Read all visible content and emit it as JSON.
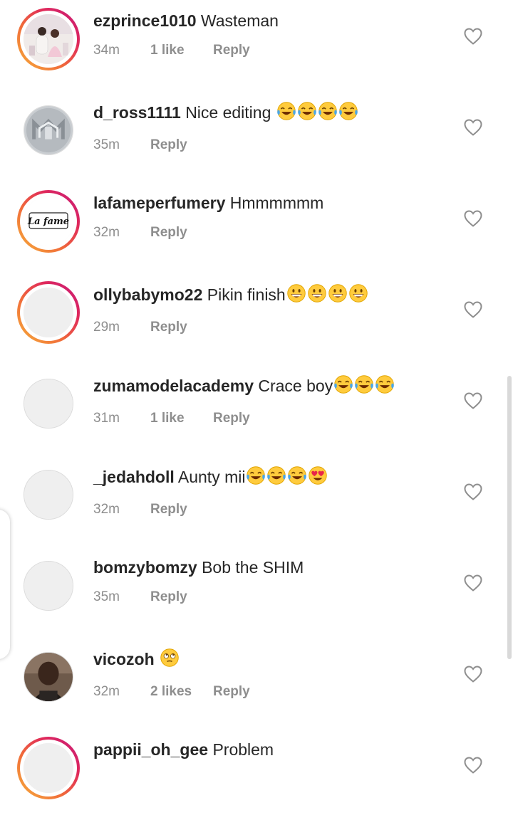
{
  "comments": [
    {
      "username": "ezprince1010",
      "text": "Wasteman",
      "emojis": [],
      "time": "34m",
      "likes": "1 like",
      "reply": "Reply",
      "ring": true,
      "avatar": "photo-couple"
    },
    {
      "username": "d_ross1111",
      "text": "Nice editing ",
      "emojis": [
        "tears-of-joy",
        "tears-of-joy",
        "tears-of-joy",
        "tears-of-joy"
      ],
      "time": "35m",
      "likes": "",
      "reply": "Reply",
      "ring": false,
      "avatar": "logo-metal"
    },
    {
      "username": "lafameperfumery",
      "text": "Hmmmmmm",
      "emojis": [],
      "time": "32m",
      "likes": "",
      "reply": "Reply",
      "ring": true,
      "avatar": "logo-lafame"
    },
    {
      "username": "ollybabymo22",
      "text": "Pikin finish",
      "emojis": [
        "grinning",
        "grinning",
        "grinning",
        "grinning"
      ],
      "time": "29m",
      "likes": "",
      "reply": "Reply",
      "ring": true,
      "avatar": "blank"
    },
    {
      "username": "zumamodelacademy",
      "text": "Crace boy",
      "emojis": [
        "tears-of-joy",
        "tears-of-joy",
        "tears-of-joy"
      ],
      "time": "31m",
      "likes": "1 like",
      "reply": "Reply",
      "ring": false,
      "avatar": "blank"
    },
    {
      "username": "_jedahdoll",
      "text": "Aunty mii",
      "emojis": [
        "tears-of-joy",
        "tears-of-joy",
        "tears-of-joy",
        "heart-eyes"
      ],
      "time": "32m",
      "likes": "",
      "reply": "Reply",
      "ring": false,
      "avatar": "blank"
    },
    {
      "username": "bomzybomzy",
      "text": "Bob the SHIM",
      "emojis": [],
      "time": "35m",
      "likes": "",
      "reply": "Reply",
      "ring": false,
      "avatar": "blank"
    },
    {
      "username": "vicozoh",
      "text": "",
      "emojis": [
        "eye-roll"
      ],
      "time": "32m",
      "likes": "2 likes",
      "reply": "Reply",
      "ring": false,
      "avatar": "photo-man"
    },
    {
      "username": "pappii_oh_gee",
      "text": "Problem",
      "emojis": [],
      "time": "",
      "likes": "",
      "reply": "",
      "ring": true,
      "avatar": "blank"
    }
  ],
  "lafame_logo_text": "La fame",
  "colors": {
    "username": "#262626",
    "meta": "#8e8e8e",
    "heart_outline": "#8e8e8e",
    "ring_start": "#f7b13a",
    "ring_end": "#c41a7d"
  }
}
